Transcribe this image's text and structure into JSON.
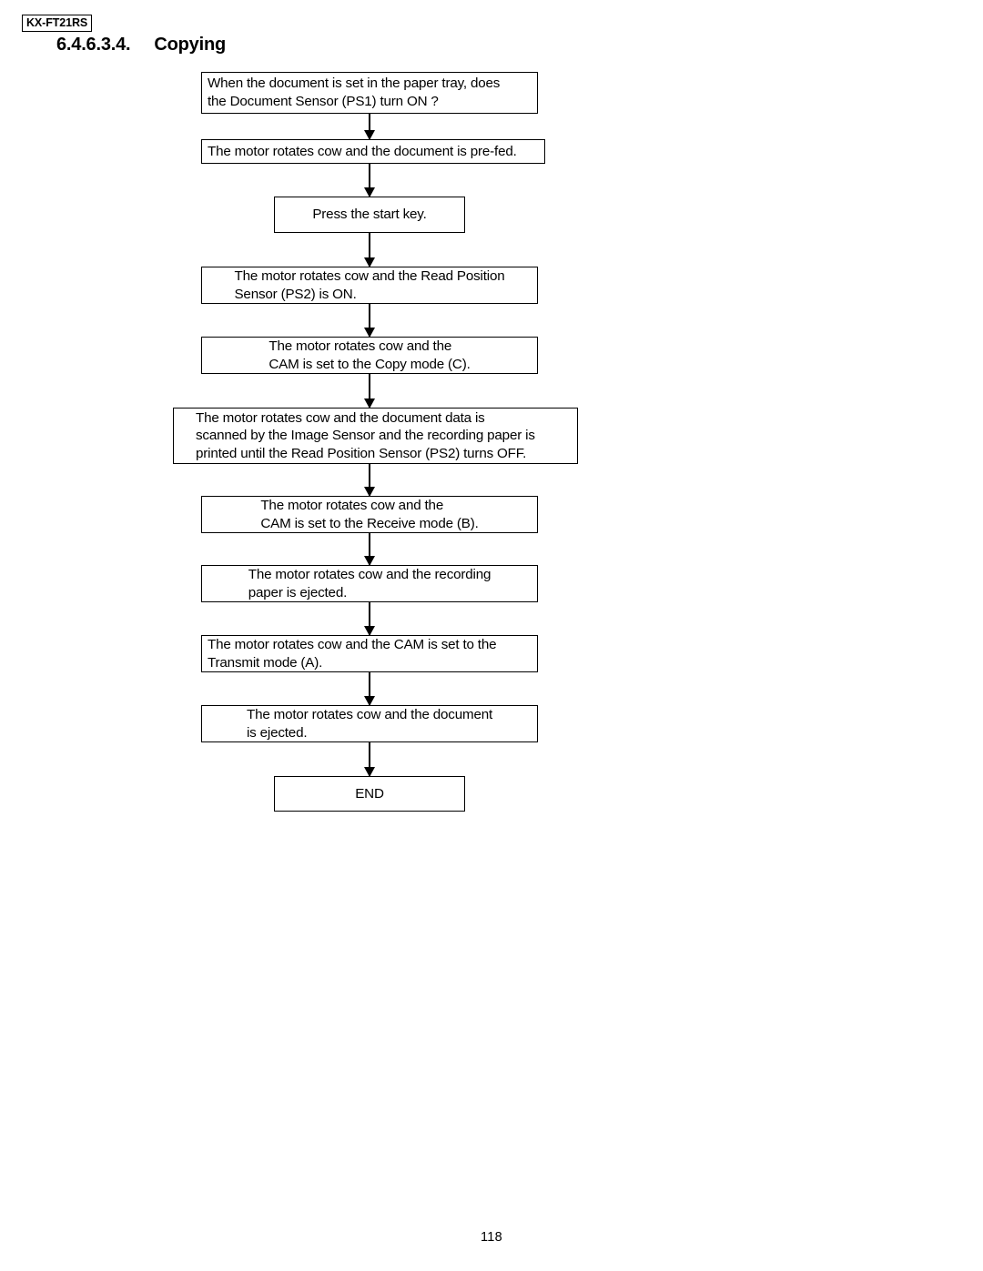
{
  "header": {
    "model_tag": "KX-FT21RS",
    "section_number": "6.4.6.3.4.",
    "section_title": "Copying"
  },
  "flowchart": {
    "nodes": [
      {
        "id": "n1",
        "text": "When the document is set in the paper tray, does\nthe Document Sensor (PS1) turn ON ?"
      },
      {
        "id": "n2",
        "text": "The motor rotates cow and the document is pre-fed."
      },
      {
        "id": "n3",
        "text": "Press the start key."
      },
      {
        "id": "n4",
        "text": "The motor rotates cow and the Read Position\nSensor (PS2) is ON."
      },
      {
        "id": "n5",
        "text": "The motor rotates cow and the\nCAM is set to the Copy mode (C)."
      },
      {
        "id": "n6",
        "text": "The motor rotates cow and the document data is\nscanned by the Image Sensor and the recording paper is\nprinted until the Read Position Sensor (PS2) turns OFF."
      },
      {
        "id": "n7",
        "text": "The motor rotates cow and the\nCAM is set to the Receive mode (B)."
      },
      {
        "id": "n8",
        "text": "The motor rotates cow and the recording\npaper is ejected."
      },
      {
        "id": "n9",
        "text": "The motor rotates cow and the CAM is set to the\nTransmit mode (A)."
      },
      {
        "id": "n10",
        "text": "The motor rotates cow and the document\nis ejected."
      },
      {
        "id": "n11",
        "text": "END"
      }
    ]
  },
  "footer": {
    "page_number": "118"
  }
}
